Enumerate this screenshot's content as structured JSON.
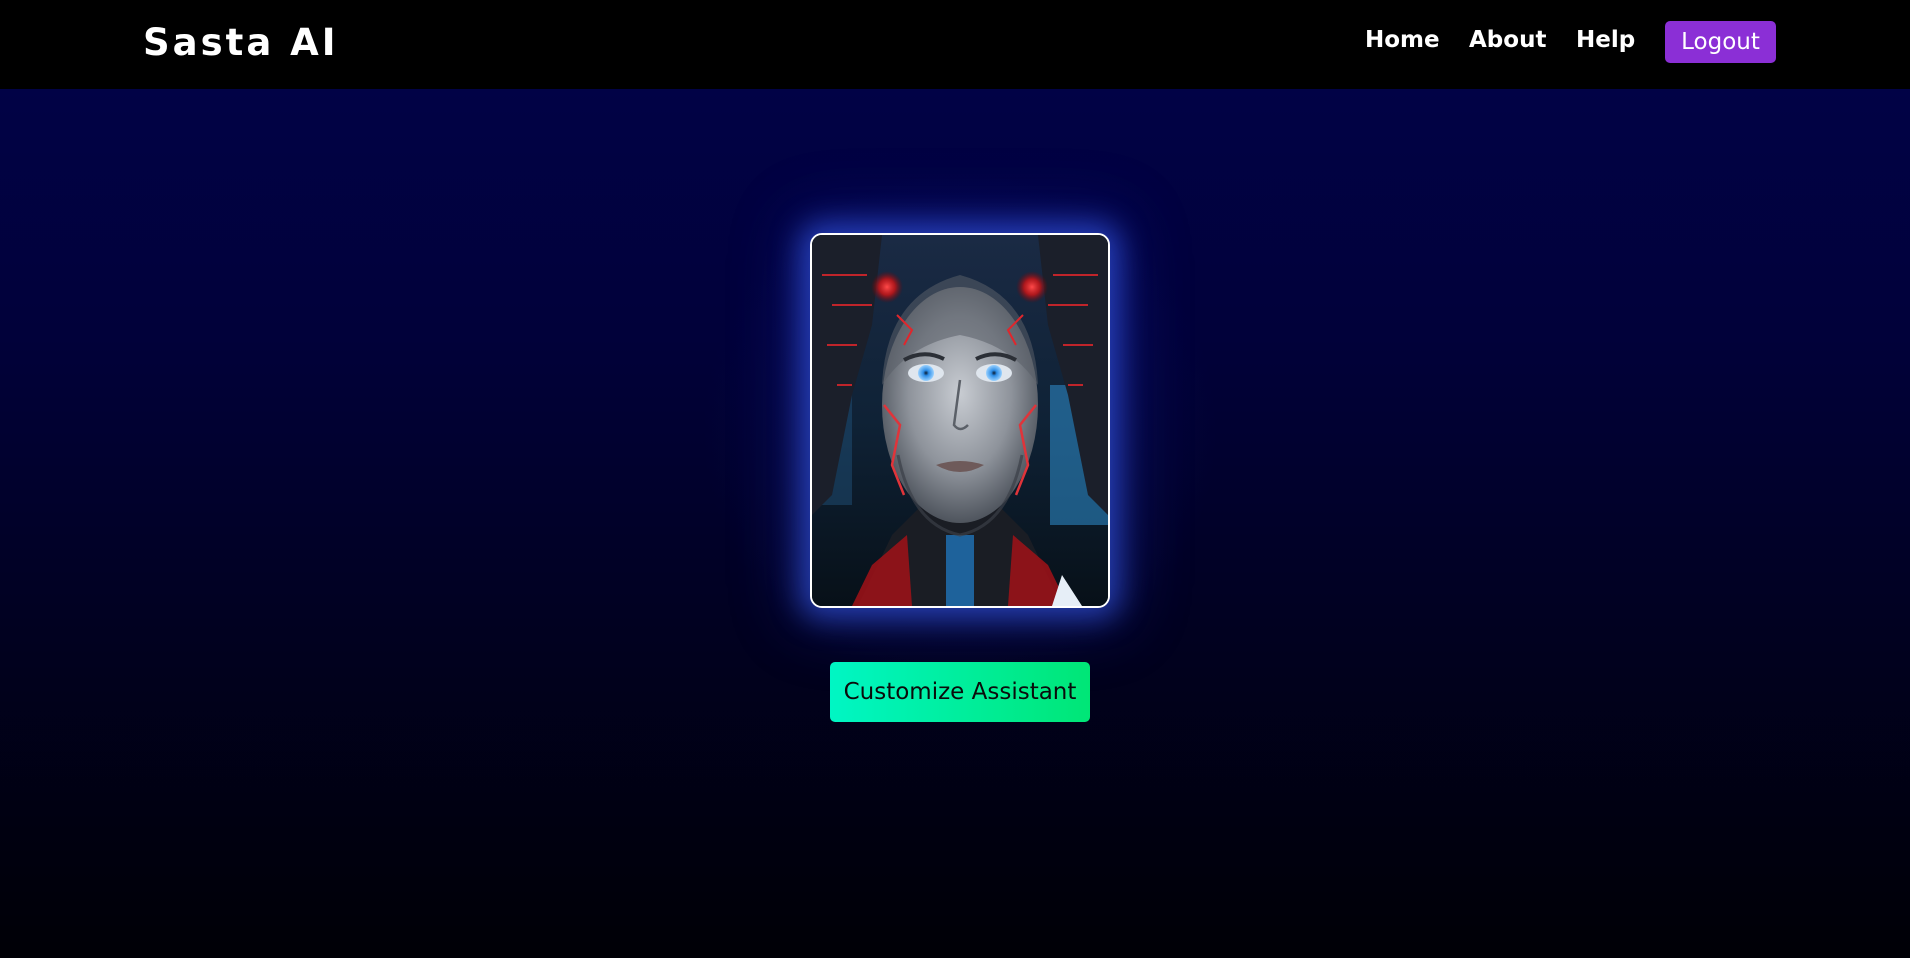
{
  "header": {
    "brand": "Sasta AI",
    "nav": [
      {
        "label": "Home"
      },
      {
        "label": "About"
      },
      {
        "label": "Help"
      }
    ],
    "logout_label": "Logout"
  },
  "main": {
    "customize_label": "Customize Assistant"
  },
  "colors": {
    "navbar": "#000000",
    "logout_button": "#8b2fd6",
    "customize_gradient_start": "#00f6c4",
    "customize_gradient_end": "#00e676",
    "background_top": "#01024a",
    "background_bottom": "#000006"
  }
}
